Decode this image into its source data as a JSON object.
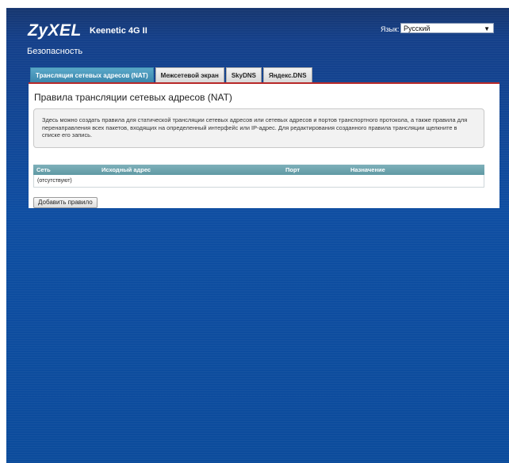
{
  "header": {
    "brand": "ZyXEL",
    "model": "Keenetic 4G II",
    "section_title": "Безопасность",
    "language_label": "Язык:",
    "language_value": "Русский"
  },
  "tabs": [
    {
      "label": "Трансляция сетевых адресов (NAT)",
      "active": true
    },
    {
      "label": "Межсетевой экран",
      "active": false
    },
    {
      "label": "SkyDNS",
      "active": false
    },
    {
      "label": "Яндекс.DNS",
      "active": false
    }
  ],
  "panel": {
    "title": "Правила трансляции сетевых адресов (NAT)",
    "info": "Здесь можно создать правила для статической трансляции сетевых адресов или сетевых адресов и портов транспортного протокола, а также правила для перенаправления всех пакетов, входящих на определенный интерфейс или IP-адрес. Для редактирования созданного правила трансляции щелкните в списке его запись.",
    "table": {
      "columns": [
        "Сеть",
        "Исходный адрес",
        "Порт",
        "Назначение"
      ],
      "empty_text": "(отсутствуют)"
    },
    "add_button": "Добавить правило"
  },
  "colors": {
    "background": "#0f4ea2",
    "active_tab": "#3b87ac",
    "panel_accent": "#b82828",
    "table_header": "#6aa2ac"
  }
}
